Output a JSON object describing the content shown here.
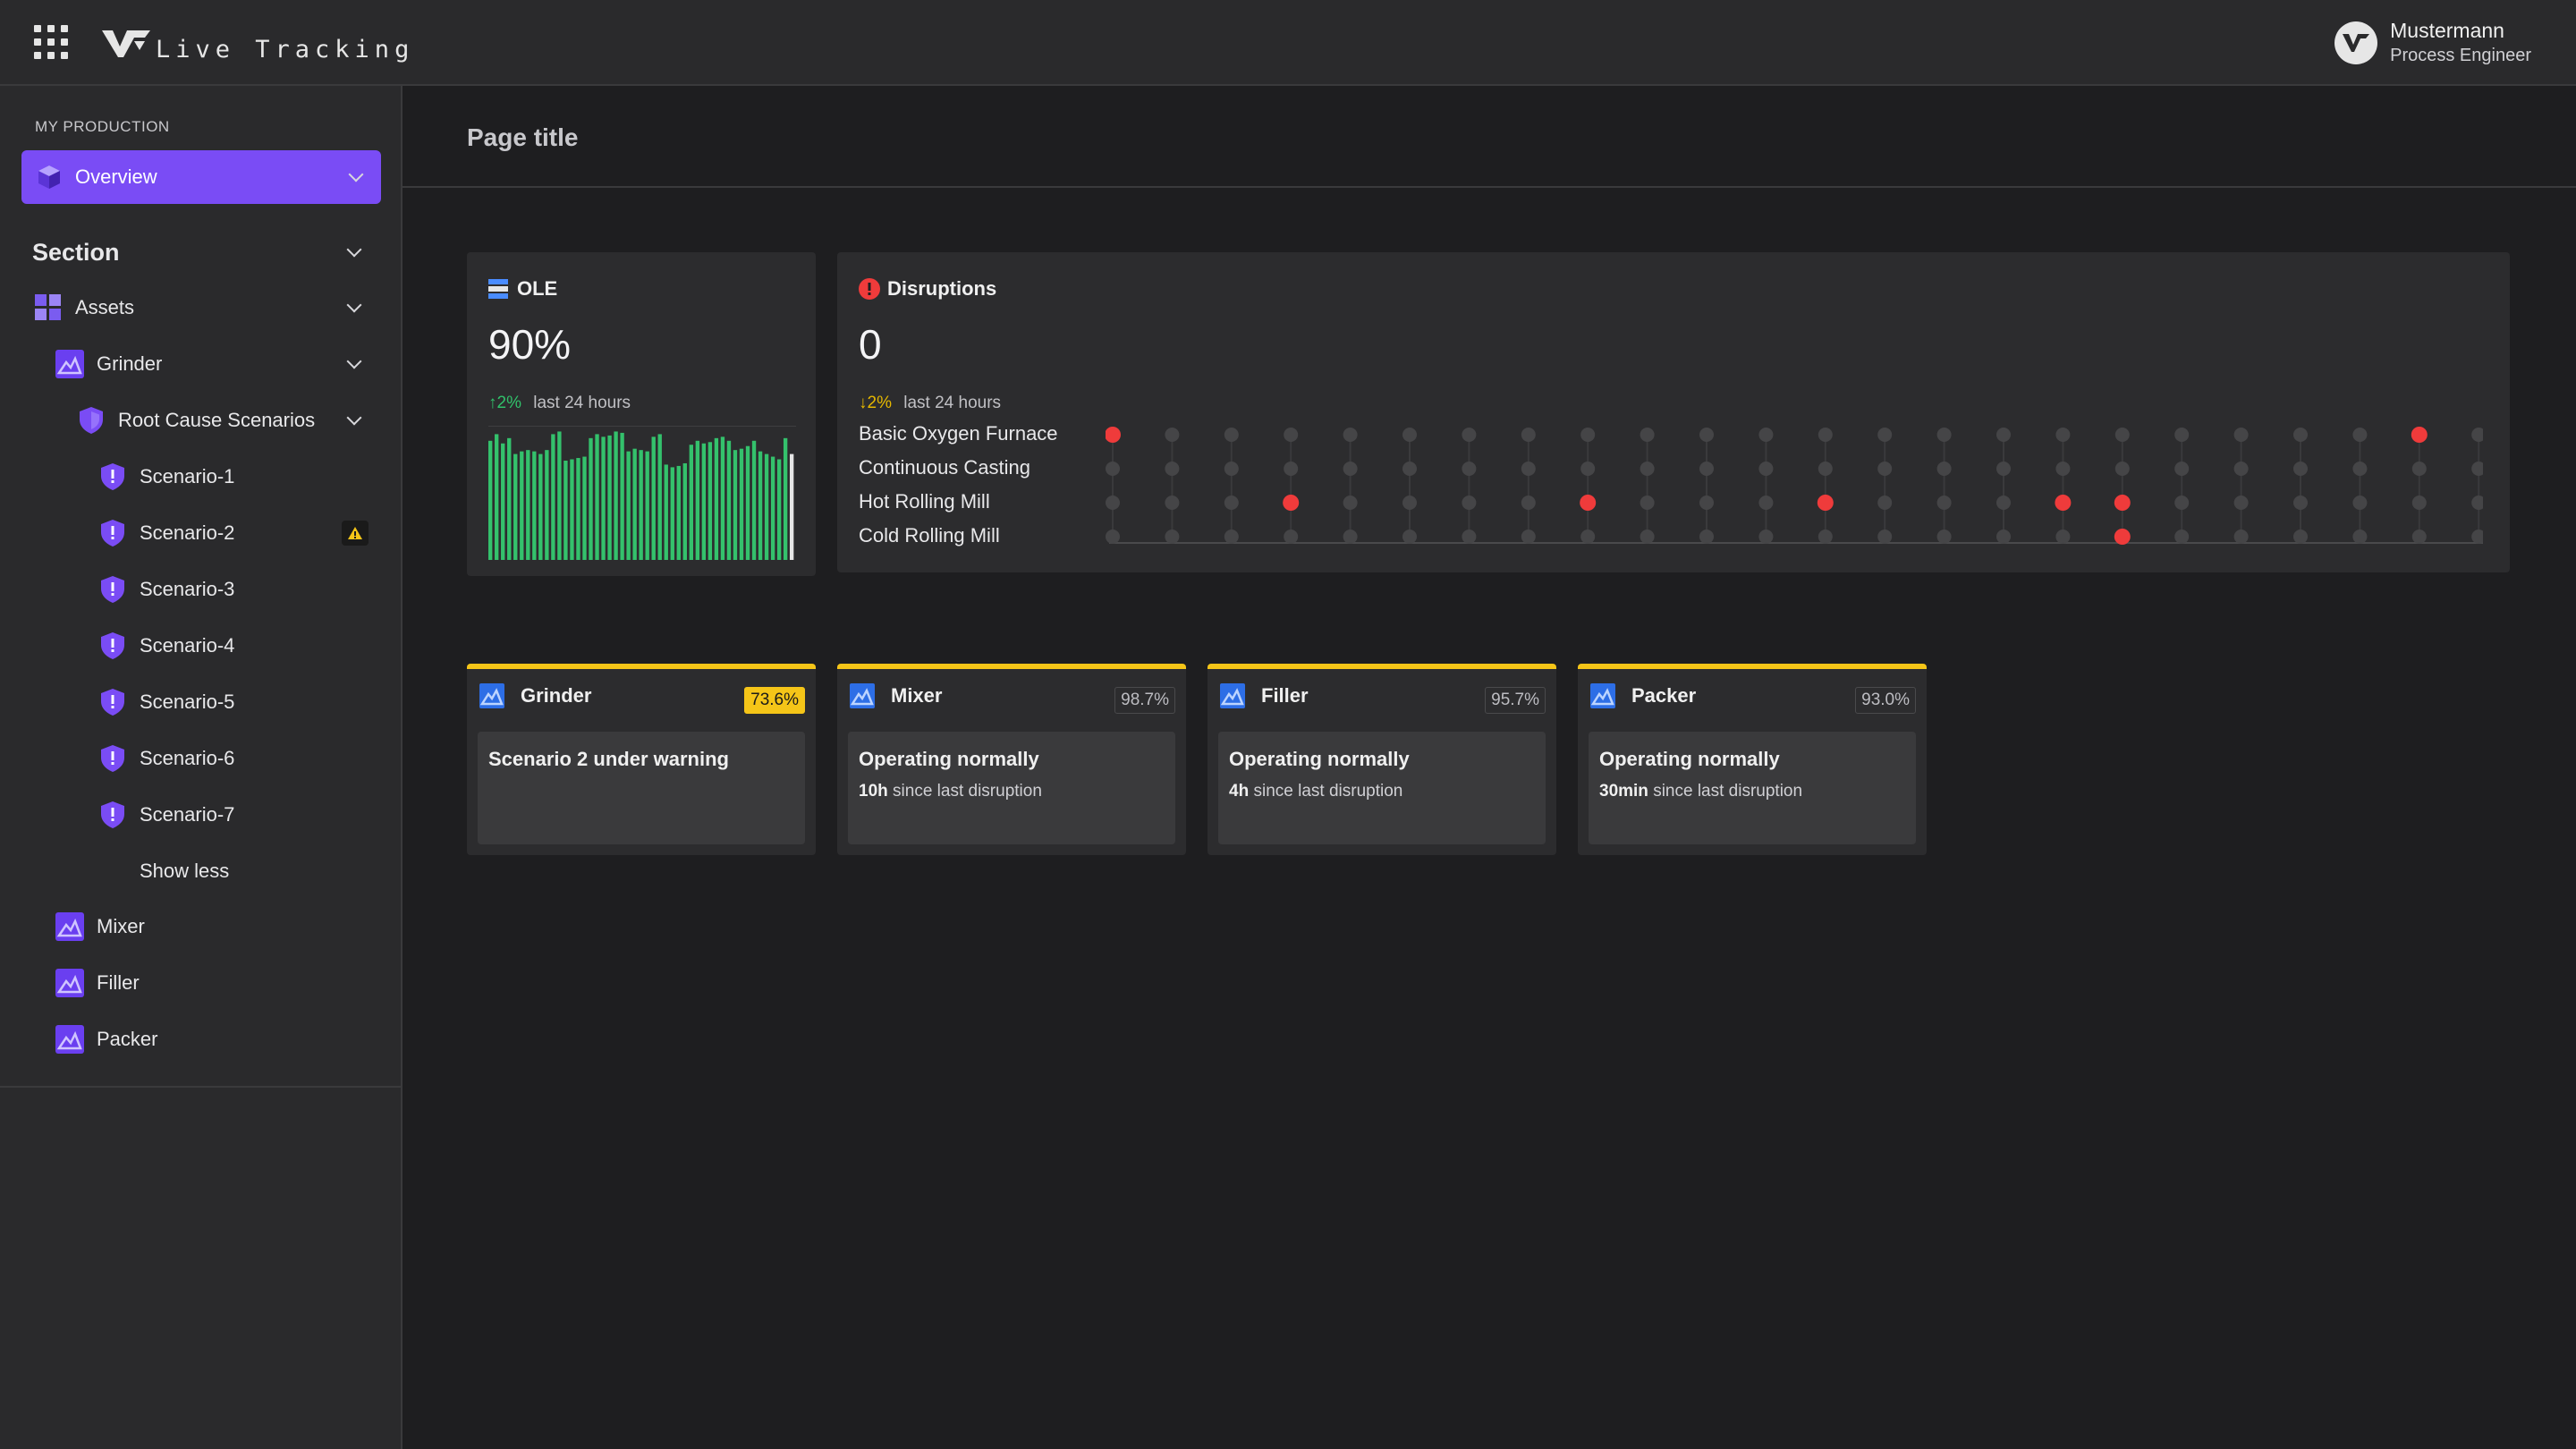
{
  "header": {
    "app_title": "Live Tracking",
    "user_name": "Mustermann",
    "user_role": "Process Engineer"
  },
  "sidebar": {
    "group_label": "MY PRODUCTION",
    "overview_label": "Overview",
    "section_title": "Section",
    "assets_label": "Assets",
    "grinder_label": "Grinder",
    "root_cause_label": "Root Cause Scenarios",
    "scenarios": [
      "Scenario-1",
      "Scenario-2",
      "Scenario-3",
      "Scenario-4",
      "Scenario-5",
      "Scenario-6",
      "Scenario-7"
    ],
    "show_less_label": "Show less",
    "other_assets": [
      "Mixer",
      "Filler",
      "Packer"
    ]
  },
  "main": {
    "page_title": "Page title",
    "ole": {
      "title": "OLE",
      "value": "90%",
      "trend_value": "2%",
      "trend_label": "last 24 hours",
      "bars": [
        0.9,
        0.95,
        0.88,
        0.92,
        0.8,
        0.82,
        0.83,
        0.82,
        0.8,
        0.83,
        0.95,
        0.97,
        0.75,
        0.76,
        0.77,
        0.78,
        0.92,
        0.95,
        0.93,
        0.94,
        0.97,
        0.96,
        0.82,
        0.84,
        0.83,
        0.82,
        0.93,
        0.95,
        0.72,
        0.7,
        0.71,
        0.73,
        0.87,
        0.9,
        0.88,
        0.89,
        0.92,
        0.93,
        0.9,
        0.83,
        0.84,
        0.86,
        0.9,
        0.82,
        0.8,
        0.78,
        0.76,
        0.92,
        0.8
      ]
    },
    "disruptions": {
      "title": "Disruptions",
      "value": "0",
      "trend_value": "2%",
      "trend_label": "last 24 hours",
      "lines": [
        "Basic Oxygen Furnace",
        "Continuous Casting",
        "Hot Rolling Mill",
        "Cold Rolling Mill"
      ],
      "columns": 24,
      "events": [
        [
          0,
          0
        ],
        [
          0,
          22
        ],
        [
          2,
          3
        ],
        [
          2,
          8
        ],
        [
          2,
          12
        ],
        [
          2,
          16
        ],
        [
          2,
          17
        ],
        [
          3,
          17
        ]
      ],
      "colors": {
        "event": "#ef3b3b",
        "idle": "#454547"
      }
    },
    "assets": [
      {
        "name": "Grinder",
        "pct": "73.6%",
        "status": "Scenario 2 under warning",
        "since_value": "",
        "since_label": "",
        "warn": true
      },
      {
        "name": "Mixer",
        "pct": "98.7%",
        "status": "Operating normally",
        "since_value": "10h",
        "since_label": "since last disruption",
        "warn": false
      },
      {
        "name": "Filler",
        "pct": "95.7%",
        "status": "Operating normally",
        "since_value": "4h",
        "since_label": "since last disruption",
        "warn": false
      },
      {
        "name": "Packer",
        "pct": "93.0%",
        "status": "Operating normally",
        "since_value": "30min",
        "since_label": "since last disruption",
        "warn": false
      }
    ]
  },
  "colors": {
    "accent": "#7a4cf5",
    "warning": "#f5c518",
    "bar_green": "#34c16c",
    "error": "#ef3b3b"
  }
}
